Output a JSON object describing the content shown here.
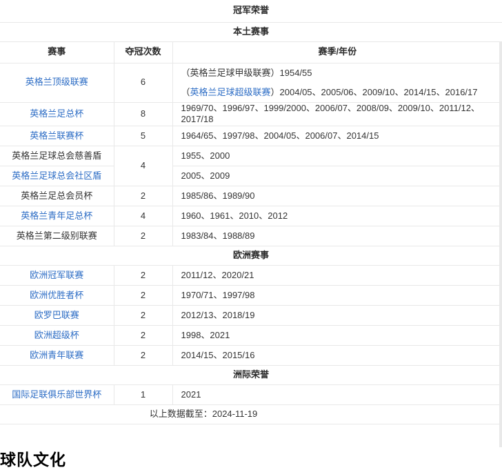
{
  "page": {
    "footer_note": "以上数据截至：2024-11-19",
    "next_section_heading": "球队文化"
  },
  "colors": {
    "link": "#2d6dc5",
    "border": "#e8e8e8",
    "text": "#333333"
  },
  "table": {
    "title": "冠军荣誉",
    "columns": {
      "competition": "赛事",
      "count": "夺冠次数",
      "seasons": "赛季/年份"
    },
    "sections": [
      {
        "heading": "本土赛事"
      },
      {
        "heading": "欧洲赛事"
      },
      {
        "heading": "洲际荣誉"
      }
    ],
    "rows": {
      "top_league": {
        "name": "英格兰顶级联赛",
        "count": "6",
        "line1": "（英格兰足球甲级联赛）1954/55",
        "line2_open": "（",
        "line2_link": "英格兰足球超级联赛",
        "line2_close": "）",
        "line2_years": "2004/05、2005/06、2009/10、2014/15、2016/17"
      },
      "fa_cup": {
        "name": "英格兰足总杯",
        "count": "8",
        "seasons": "1969/70、1996/97、1999/2000、2006/07、2008/09、2009/10、2011/12、2017/18"
      },
      "league_cup": {
        "name": "英格兰联赛杯",
        "count": "5",
        "seasons": "1964/65、1997/98、2004/05、2006/07、2014/15"
      },
      "charity_shield": {
        "name": "英格兰足球总会慈善盾",
        "count": "4",
        "seasons": "1955、2000"
      },
      "community_shield": {
        "name": "英格兰足球总会社区盾",
        "seasons": "2005、2009"
      },
      "full_members_cup": {
        "name": "英格兰足总会员杯",
        "count": "2",
        "seasons": "1985/86、1989/90"
      },
      "fa_youth_cup": {
        "name": "英格兰青年足总杯",
        "count": "4",
        "seasons": "1960、1961、2010、2012"
      },
      "second_division": {
        "name": "英格兰第二级别联赛",
        "count": "2",
        "seasons": "1983/84、1988/89"
      },
      "champions_league": {
        "name": "欧洲冠军联赛",
        "count": "2",
        "seasons": "2011/12、2020/21"
      },
      "cup_winners_cup": {
        "name": "欧洲优胜者杯",
        "count": "2",
        "seasons": "1970/71、1997/98"
      },
      "europa_league": {
        "name": "欧罗巴联赛",
        "count": "2",
        "seasons": "2012/13、2018/19"
      },
      "uefa_super_cup": {
        "name": "欧洲超级杯",
        "count": "2",
        "seasons": "1998、2021"
      },
      "uefa_youth_league": {
        "name": "欧洲青年联赛",
        "count": "2",
        "seasons": "2014/15、2015/16"
      },
      "club_world_cup": {
        "name": "国际足联俱乐部世界杯",
        "count": "1",
        "seasons": "2021"
      }
    }
  }
}
